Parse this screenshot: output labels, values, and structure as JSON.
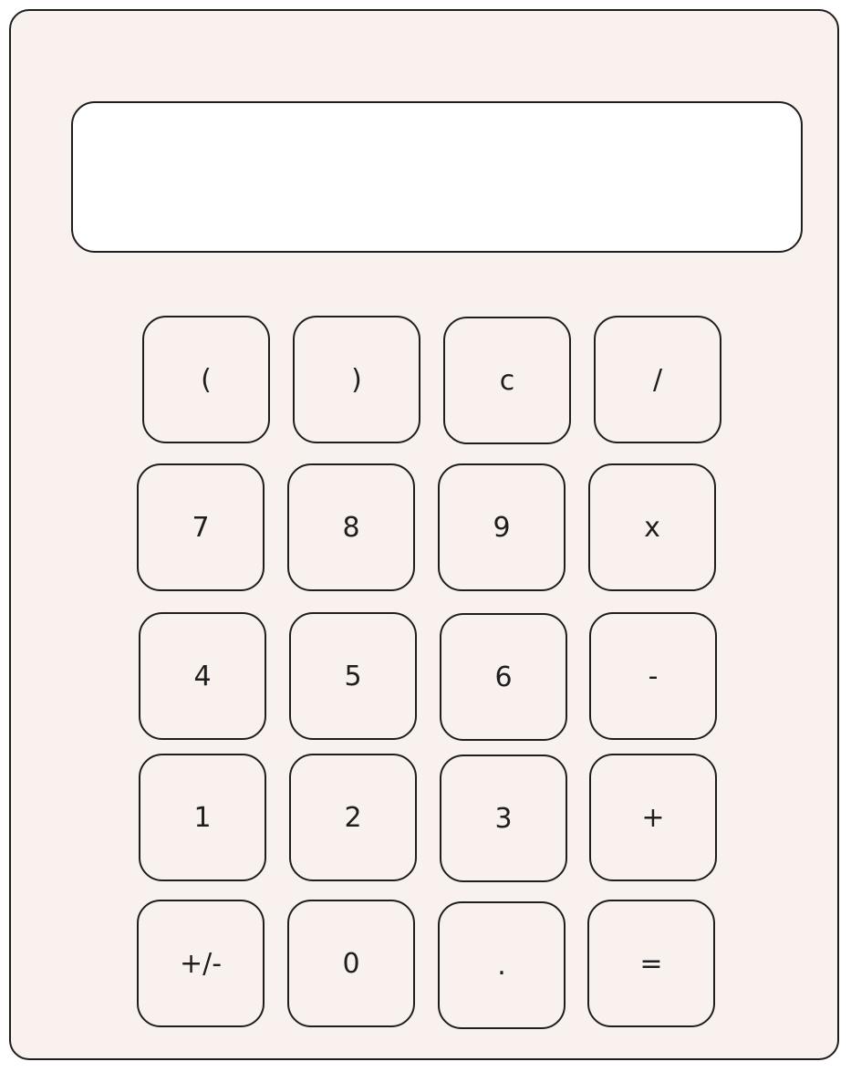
{
  "display": {
    "value": ""
  },
  "keys": {
    "open_paren": "(",
    "close_paren": ")",
    "clear": "c",
    "divide": "/",
    "seven": "7",
    "eight": "8",
    "nine": "9",
    "multiply": "x",
    "four": "4",
    "five": "5",
    "six": "6",
    "subtract": "-",
    "one": "1",
    "two": "2",
    "three": "3",
    "add": "+",
    "negate": "+/-",
    "zero": "0",
    "decimal": ".",
    "equals": "="
  },
  "colors": {
    "body": "#f8f1ee",
    "display": "#ffffff",
    "stroke": "#1e1e1e"
  }
}
